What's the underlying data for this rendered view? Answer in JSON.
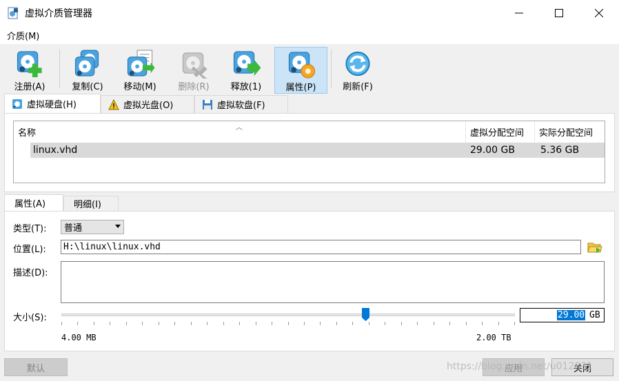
{
  "window": {
    "title": "虚拟介质管理器"
  },
  "menu": {
    "items": [
      "介质(M)"
    ]
  },
  "toolbar": {
    "register": "注册(A)",
    "copy": "复制(C)",
    "move": "移动(M)",
    "remove": "删除(R)",
    "release": "释放(1)",
    "properties": "属性(P)",
    "refresh": "刷新(F)"
  },
  "tabs": {
    "hdd": "虚拟硬盘(H)",
    "cd": "虚拟光盘(O)",
    "floppy": "虚拟软盘(F)"
  },
  "list": {
    "columns": {
      "name": "名称",
      "virtual_size": "虚拟分配空间",
      "actual_size": "实际分配空间"
    },
    "rows": [
      {
        "name": "linux.vhd",
        "virtual_size": "29.00 GB",
        "actual_size": "5.36 GB"
      }
    ]
  },
  "detail_tabs": {
    "attributes": "属性(A)",
    "information": "明细(I)"
  },
  "form": {
    "type_label": "类型(T):",
    "type_value": "普通",
    "location_label": "位置(L):",
    "location_value": "H:\\linux\\linux.vhd",
    "description_label": "描述(D):",
    "description_value": "",
    "size_label": "大小(S):",
    "size_value": "29.00",
    "size_unit": "GB",
    "size_min": "4.00 MB",
    "size_max": "2.00 TB"
  },
  "buttons": {
    "reset": "默认",
    "apply": "应用",
    "close": "关闭"
  },
  "watermark": "https://blog.csdn.net/u012831"
}
